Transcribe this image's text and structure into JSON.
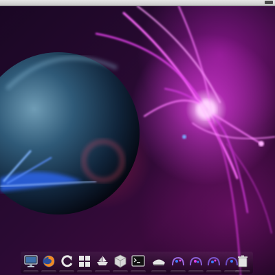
{
  "desktop": {
    "wallpaper": "space-planet-purple-energy",
    "accent_colors": {
      "magenta": "#e040e8",
      "blue_flare": "#3a7cff",
      "planet": "#2d5b7a"
    }
  },
  "dock": {
    "items": [
      {
        "icon": "monitor-icon",
        "name": "dock-item-display"
      },
      {
        "icon": "firefox-icon",
        "name": "dock-item-browser"
      },
      {
        "icon": "refresh-icon",
        "name": "dock-item-update"
      },
      {
        "icon": "windows-grid-icon",
        "name": "dock-item-workspaces"
      },
      {
        "icon": "boat-icon",
        "name": "dock-item-app"
      },
      {
        "icon": "package-box-icon",
        "name": "dock-item-package"
      },
      {
        "icon": "terminal-icon",
        "name": "dock-item-terminal"
      },
      {
        "icon": "drive-icon",
        "name": "dock-item-drive"
      },
      {
        "icon": "bubble-icon-1",
        "name": "dock-item-bubble-1"
      },
      {
        "icon": "bubble-icon-2",
        "name": "dock-item-bubble-2"
      },
      {
        "icon": "bubble-icon-3",
        "name": "dock-item-bubble-3"
      },
      {
        "icon": "bubble-icon-4",
        "name": "dock-item-bubble-4"
      },
      {
        "icon": "trash-icon",
        "name": "dock-item-trash"
      }
    ]
  }
}
